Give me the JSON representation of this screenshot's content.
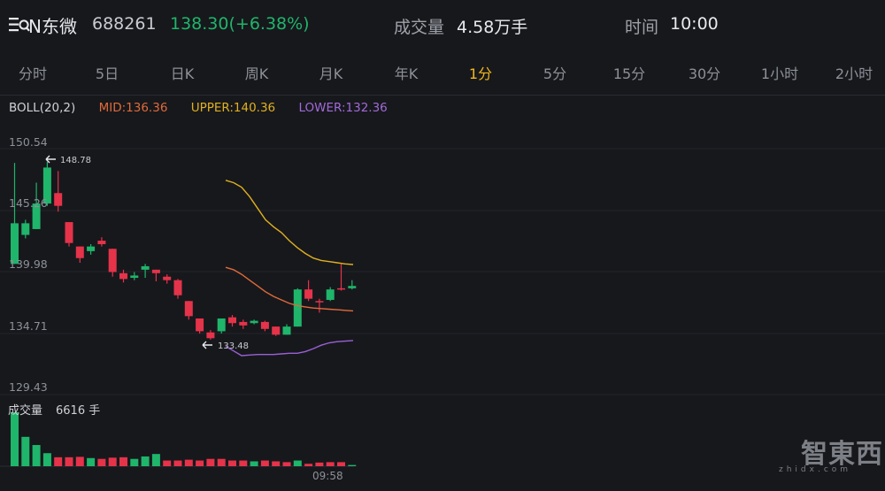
{
  "header": {
    "name": "N东微",
    "code": "688261",
    "price": "138.30(+6.38%)",
    "volume_label": "成交量",
    "volume_value": "4.58万手",
    "time_label": "时间",
    "time_value": "10:00"
  },
  "tabs": [
    "分时",
    "5日",
    "日K",
    "周K",
    "月K",
    "年K",
    "1分",
    "5分",
    "15分",
    "30分",
    "1小时",
    "2小时"
  ],
  "active_tab": "1分",
  "indicator": {
    "name": "BOLL(20,2)",
    "mid": "MID:136.36",
    "upper": "UPPER:140.36",
    "lower": "LOWER:132.36"
  },
  "price_axis": [
    "150.54",
    "145.26",
    "139.98",
    "134.71",
    "129.43"
  ],
  "annotations": {
    "high": "148.78",
    "low": "133.48"
  },
  "volume_panel": {
    "title": "成交量",
    "value": "6616 手",
    "time_tick": "09:58"
  },
  "watermark": {
    "cn": "智東西",
    "en": "zhidx.com"
  },
  "colors": {
    "up": "#1fb56b",
    "down": "#e5334a",
    "mid": "#e06a3a",
    "upper": "#e0b020",
    "lower": "#9a60d6",
    "active_tab": "#f0b81c"
  },
  "chart_data": {
    "type": "candlestick",
    "y_range": [
      129.43,
      150.54
    ],
    "candles": [
      {
        "o": 140.0,
        "c": 143.5,
        "h": 148.7,
        "l": 140.0
      },
      {
        "o": 142.5,
        "c": 143.5,
        "h": 143.8,
        "l": 142.2
      },
      {
        "o": 143.0,
        "c": 145.2,
        "h": 147.0,
        "l": 143.0
      },
      {
        "o": 145.2,
        "c": 148.3,
        "h": 148.8,
        "l": 145.0
      },
      {
        "o": 146.1,
        "c": 145.0,
        "h": 148.0,
        "l": 144.5
      },
      {
        "o": 143.6,
        "c": 141.8,
        "h": 143.6,
        "l": 141.5
      },
      {
        "o": 141.5,
        "c": 140.5,
        "h": 141.5,
        "l": 140.1
      },
      {
        "o": 141.1,
        "c": 141.5,
        "h": 141.7,
        "l": 140.8
      },
      {
        "o": 142.0,
        "c": 141.7,
        "h": 142.3,
        "l": 141.5
      },
      {
        "o": 141.3,
        "c": 139.3,
        "h": 141.3,
        "l": 138.9
      },
      {
        "o": 139.2,
        "c": 138.7,
        "h": 139.5,
        "l": 138.4
      },
      {
        "o": 138.8,
        "c": 139.0,
        "h": 139.3,
        "l": 138.6
      },
      {
        "o": 139.5,
        "c": 139.8,
        "h": 140.0,
        "l": 138.8
      },
      {
        "o": 139.5,
        "c": 139.2,
        "h": 139.5,
        "l": 138.5
      },
      {
        "o": 138.9,
        "c": 138.6,
        "h": 139.1,
        "l": 138.3
      },
      {
        "o": 138.6,
        "c": 137.3,
        "h": 138.7,
        "l": 137.0
      },
      {
        "o": 136.8,
        "c": 135.5,
        "h": 136.8,
        "l": 135.2
      },
      {
        "o": 135.3,
        "c": 134.2,
        "h": 135.3,
        "l": 134.0
      },
      {
        "o": 134.1,
        "c": 133.6,
        "h": 134.3,
        "l": 133.48
      },
      {
        "o": 134.2,
        "c": 135.3,
        "h": 135.3,
        "l": 134.0
      },
      {
        "o": 135.4,
        "c": 134.9,
        "h": 135.6,
        "l": 134.6
      },
      {
        "o": 135.0,
        "c": 134.7,
        "h": 135.2,
        "l": 134.4
      },
      {
        "o": 134.9,
        "c": 135.1,
        "h": 135.2,
        "l": 134.8
      },
      {
        "o": 135.0,
        "c": 134.4,
        "h": 135.1,
        "l": 134.2
      },
      {
        "o": 134.6,
        "c": 133.9,
        "h": 134.6,
        "l": 133.8
      },
      {
        "o": 133.9,
        "c": 134.6,
        "h": 134.8,
        "l": 133.9
      },
      {
        "o": 134.6,
        "c": 137.8,
        "h": 137.9,
        "l": 134.6
      },
      {
        "o": 137.8,
        "c": 137.0,
        "h": 138.6,
        "l": 136.8
      },
      {
        "o": 136.8,
        "c": 136.7,
        "h": 137.0,
        "l": 135.8
      },
      {
        "o": 136.9,
        "c": 137.8,
        "h": 138.0,
        "l": 136.8
      },
      {
        "o": 137.9,
        "c": 137.8,
        "h": 140.0,
        "l": 137.7
      },
      {
        "o": 137.9,
        "c": 138.1,
        "h": 138.6,
        "l": 137.8
      }
    ],
    "upper": [
      147.2,
      147.0,
      146.6,
      145.8,
      144.8,
      143.8,
      143.2,
      142.7,
      142.0,
      141.4,
      140.9,
      140.5,
      140.3,
      140.2,
      140.1,
      140.0,
      139.95
    ],
    "mid": [
      139.7,
      139.5,
      139.1,
      138.6,
      138.1,
      137.6,
      137.2,
      136.9,
      136.6,
      136.4,
      136.3,
      136.2,
      136.15,
      136.1,
      136.05,
      136.0,
      135.95
    ],
    "lower": [
      132.9,
      132.5,
      132.1,
      132.15,
      132.2,
      132.2,
      132.2,
      132.25,
      132.3,
      132.3,
      132.45,
      132.7,
      133.0,
      133.2,
      133.3,
      133.35,
      133.4
    ],
    "band_start_index": 16,
    "volume": [
      {
        "v": 6616,
        "up": true
      },
      {
        "v": 3600,
        "up": true
      },
      {
        "v": 2600,
        "up": true
      },
      {
        "v": 1600,
        "up": true
      },
      {
        "v": 1100,
        "up": false
      },
      {
        "v": 1100,
        "up": false
      },
      {
        "v": 1150,
        "up": false
      },
      {
        "v": 1000,
        "up": true
      },
      {
        "v": 900,
        "up": false
      },
      {
        "v": 1050,
        "up": false
      },
      {
        "v": 1100,
        "up": false
      },
      {
        "v": 900,
        "up": true
      },
      {
        "v": 1200,
        "up": true
      },
      {
        "v": 1500,
        "up": true
      },
      {
        "v": 700,
        "up": false
      },
      {
        "v": 700,
        "up": false
      },
      {
        "v": 800,
        "up": false
      },
      {
        "v": 700,
        "up": false
      },
      {
        "v": 900,
        "up": false
      },
      {
        "v": 900,
        "up": false
      },
      {
        "v": 700,
        "up": false
      },
      {
        "v": 700,
        "up": false
      },
      {
        "v": 600,
        "up": true
      },
      {
        "v": 700,
        "up": false
      },
      {
        "v": 600,
        "up": false
      },
      {
        "v": 500,
        "up": false
      },
      {
        "v": 700,
        "up": true
      },
      {
        "v": 300,
        "up": false
      },
      {
        "v": 450,
        "up": false
      },
      {
        "v": 500,
        "up": false
      },
      {
        "v": 500,
        "up": false
      },
      {
        "v": 150,
        "up": true
      }
    ]
  }
}
